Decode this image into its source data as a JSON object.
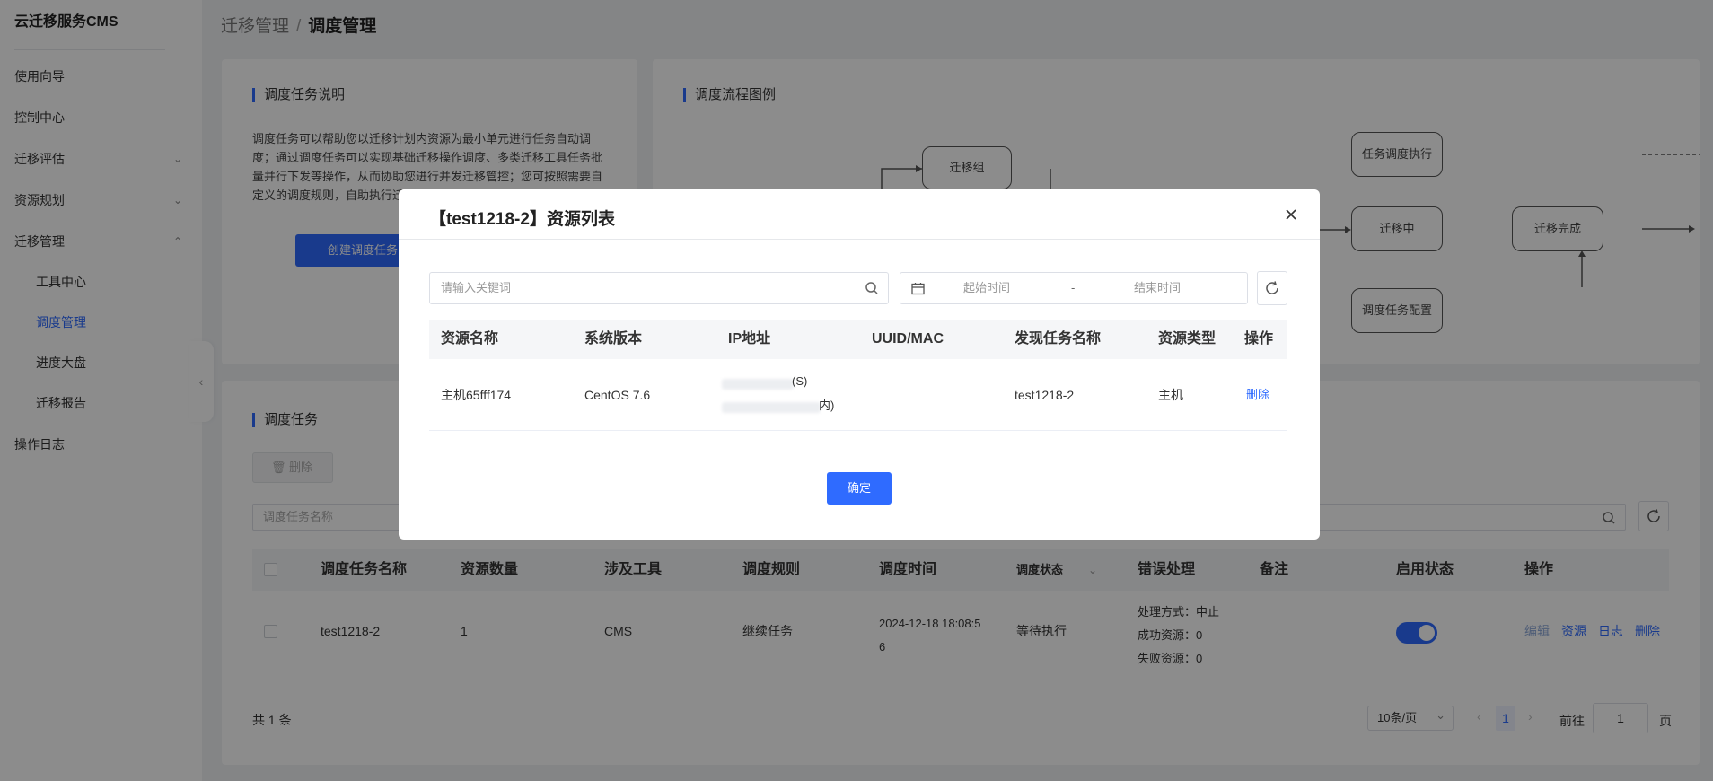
{
  "app": {
    "title": "云迁移服务CMS"
  },
  "sidebar": {
    "items": [
      {
        "label": "使用向导"
      },
      {
        "label": "控制中心"
      },
      {
        "label": "迁移评估",
        "chevron": "down"
      },
      {
        "label": "资源规划",
        "chevron": "down"
      },
      {
        "label": "迁移管理",
        "chevron": "up"
      },
      {
        "label": "工具中心"
      },
      {
        "label": "调度管理"
      },
      {
        "label": "进度大盘"
      },
      {
        "label": "迁移报告"
      },
      {
        "label": "操作日志"
      }
    ]
  },
  "breadcrumb": {
    "parent": "迁移管理",
    "separator": "/",
    "current": "调度管理"
  },
  "info_card": {
    "title": "调度任务说明",
    "text": "调度任务可以帮助您以迁移计划内资源为最小单元进行任务自动调度；通过调度任务可以实现基础迁移操作调度、多类迁移工具任务批量并行下发等操作，从而协助您进行并发迁移管控；您可按照需要自定义的调度规则，自助执行迁移任务。",
    "create_button": "创建调度任务"
  },
  "flow_card": {
    "title": "调度流程图例",
    "nodes": {
      "group": "迁移组",
      "exec": "任务调度执行",
      "migrating": "迁移中",
      "done": "迁移完成",
      "config": "调度任务配置"
    }
  },
  "task_card": {
    "title": "调度任务",
    "delete_button": "删除",
    "search_placeholder": "调度任务名称",
    "columns": [
      "调度任务名称",
      "资源数量",
      "涉及工具",
      "调度规则",
      "调度时间",
      "调度状态",
      "错误处理",
      "备注",
      "启用状态",
      "操作"
    ],
    "rows": [
      {
        "name": "test1218-2",
        "count": "1",
        "tool": "CMS",
        "rule": "继续任务",
        "time_line1": "2024-12-18 18:08:5",
        "time_line2": "6",
        "status": "等待执行",
        "error_line1": "处理方式：中止",
        "error_line2": "成功资源：0",
        "error_line3": "失败资源：0",
        "enabled": true,
        "actions": {
          "edit": "编辑",
          "resource": "资源",
          "log": "日志",
          "delete": "删除"
        }
      }
    ],
    "total": "共 1 条",
    "page_size": "10条/页",
    "current_page": "1",
    "goto_label": "前往",
    "goto_value": "1",
    "page_suffix": "页"
  },
  "modal": {
    "title": "【test1218-2】资源列表",
    "search_placeholder": "请输入关键词",
    "start_placeholder": "起始时间",
    "date_sep": "-",
    "end_placeholder": "结束时间",
    "columns": [
      "资源名称",
      "系统版本",
      "IP地址",
      "UUID/MAC",
      "发现任务名称",
      "资源类型",
      "操作"
    ],
    "rows": [
      {
        "name": "主机65fff174",
        "os": "CentOS 7.6",
        "ip_tail1": "(S)",
        "ip_tail2": "内)",
        "uuid": "",
        "task": "test1218-2",
        "type": "主机",
        "action": "删除"
      }
    ],
    "confirm_button": "确定"
  },
  "colors": {
    "primary": "#2f6bff",
    "mask": "rgba(0,0,0,0.45)"
  }
}
